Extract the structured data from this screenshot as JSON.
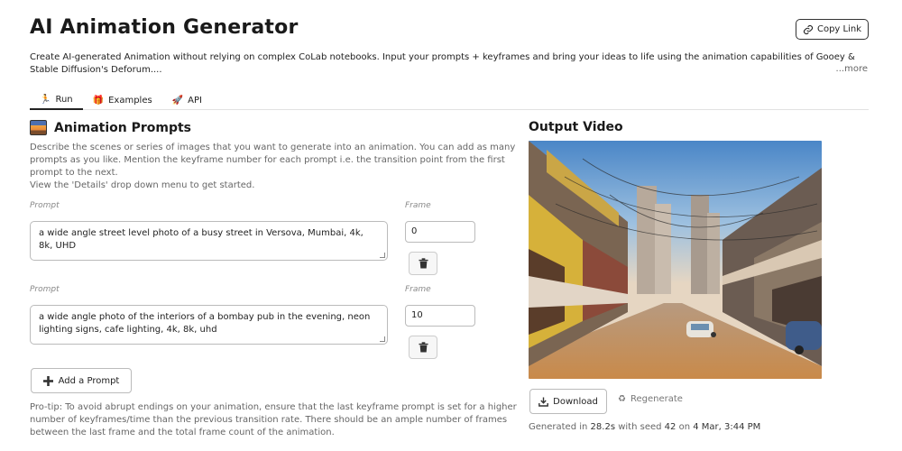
{
  "header": {
    "title": "AI Animation Generator",
    "copy_link_label": "Copy Link",
    "description": "Create AI-generated Animation without relying on complex CoLab notebooks. Input your prompts + keyframes and bring your ideas to life using the animation capabilities of Gooey & Stable Diffusion's Deforum....",
    "more_label": "...more"
  },
  "tabs": [
    {
      "label": "Run",
      "icon": "runner-icon"
    },
    {
      "label": "Examples",
      "icon": "gift-icon"
    },
    {
      "label": "API",
      "icon": "rocket-icon"
    }
  ],
  "prompts_section": {
    "title": "Animation Prompts",
    "help": "Describe the scenes or series of images that you want to generate into an animation. You can add as many prompts as you like. Mention the keyframe number for each prompt i.e. the transition point from the first prompt to the next.\nView the 'Details' drop down menu to get started.",
    "prompt_label": "Prompt",
    "frame_label": "Frame",
    "rows": [
      {
        "prompt": "a wide angle street level photo of a busy street in Versova, Mumbai, 4k, 8k, UHD",
        "frame": "0"
      },
      {
        "prompt": "a wide angle photo of the interiors of a bombay pub in the evening, neon lighting signs, cafe lighting, 4k, 8k, uhd",
        "frame": "10"
      }
    ],
    "add_button_label": "Add a Prompt",
    "protip": "Pro-tip: To avoid abrupt endings on your animation, ensure that the last keyframe prompt is set for a higher number of keyframes/time than the previous transition rate. There should be an ample number of frames between the last frame and the total frame count of the animation."
  },
  "output": {
    "title": "Output Video",
    "download_label": "Download",
    "regenerate_label": "Regenerate",
    "gen_prefix": "Generated in",
    "gen_time": "28.2s",
    "gen_seed_prefix": "with seed",
    "gen_seed": "42",
    "gen_on": "on",
    "gen_date": "4 Mar, 3:44 PM"
  }
}
